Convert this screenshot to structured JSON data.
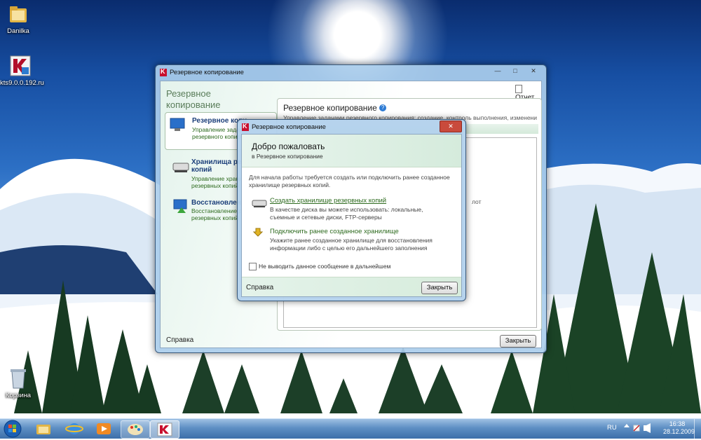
{
  "desktop": {
    "icons": [
      {
        "label": "Danilka",
        "icon": "folder-icon"
      },
      {
        "label": "kts9.0.0.192.ru",
        "icon": "kaspersky-installer-icon"
      },
      {
        "label": "Корзина",
        "icon": "recycle-bin-icon"
      }
    ]
  },
  "main_window": {
    "title": "Резервное копирование",
    "header_title": "Резервное копирование",
    "report_label": "Отчет",
    "content_title": "Резервное копирование",
    "content_desc": "Управление задачами резервного копирования: создание, контроль выполнения, изменение",
    "side_truncated": "лот",
    "nav": [
      {
        "title": "Резервное копи",
        "desc1": "Управление задач",
        "desc2": "резервного копиров",
        "icon": "backup-monitor-icon"
      },
      {
        "title": "Хранилища рез",
        "title2": "копий",
        "desc1": "Управление храни",
        "desc2": "резервных копий",
        "icon": "storage-drive-icon"
      },
      {
        "title": "Восстановлен",
        "desc1": "Восстановление д",
        "desc2": "резервных копий",
        "icon": "restore-icon"
      }
    ],
    "help_label": "Справка",
    "close_label": "Закрыть"
  },
  "dialog": {
    "title": "Резервное копирование",
    "heading": "Добро пожаловать",
    "subheading": "в Резервное копирование",
    "intro": "Для начала работы требуется создать или подключить ранее созданное хранилище резервных копий.",
    "option1": {
      "link": "Создать хранилище резервных копий",
      "desc": "В качестве диска вы можете использовать: локальные, съемные и сетевые диски, FTP-серверы"
    },
    "option2": {
      "link": "Подключить ранее созданное хранилище",
      "desc": "Укажите ранее созданное хранилище для восстановления информации либо с целью его дальнейшего заполнения"
    },
    "checkbox_label": "Не выводить данное сообщение в дальнейшем",
    "help_label": "Справка",
    "close_label": "Закрыть"
  },
  "taskbar": {
    "language": "RU",
    "time": "16:38",
    "date": "28.12.2009",
    "items": [
      "start-orb-icon",
      "explorer-icon",
      "internet-explorer-icon",
      "media-player-icon",
      "paint-icon",
      "kaspersky-icon"
    ]
  }
}
